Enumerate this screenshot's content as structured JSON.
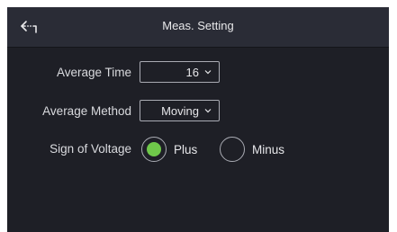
{
  "header": {
    "title": "Meas. Setting",
    "back_icon": "back-arrow-icon"
  },
  "settings": {
    "average_time": {
      "label": "Average Time",
      "value": "16"
    },
    "average_method": {
      "label": "Average Method",
      "value": "Moving"
    },
    "sign_of_voltage": {
      "label": "Sign of Voltage",
      "options": [
        {
          "label": "Plus",
          "selected": true
        },
        {
          "label": "Minus",
          "selected": false
        }
      ]
    }
  },
  "colors": {
    "background": "#1e1f26",
    "header": "#2a2c36",
    "accent": "#6fc84a",
    "border": "#a9abb3"
  }
}
